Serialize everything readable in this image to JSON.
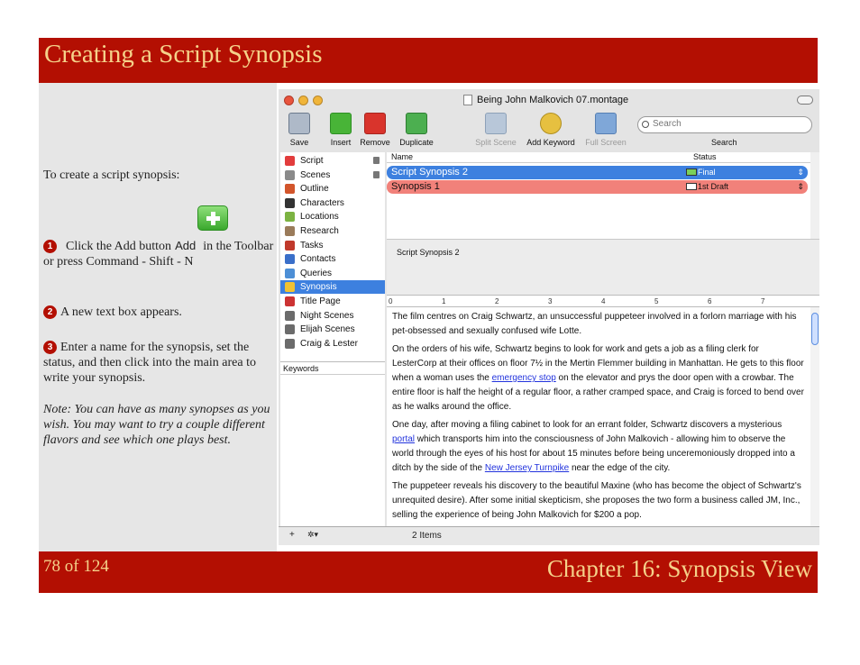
{
  "header": {
    "title": "Creating a Script Synopsis"
  },
  "instructions": {
    "intro": "To create a script synopsis:",
    "step1_num": "1",
    "step1_before": "Click the Add button",
    "step1_icon_label": "Add",
    "step1_after": "in the Toolbar or press Command - Shift - N",
    "step2_num": "2",
    "step2": "A new text box appears.",
    "step3_num": "3",
    "step3": "Enter a name for the synopsis, set the status, and then click into the main area to write your synopsis.",
    "note": "Note: You can have as many synopses as you wish. You may want to try a couple different flavors and see which one plays best."
  },
  "footer": {
    "page": "78 of 124",
    "chapter": "Chapter 16: Synopsis View"
  },
  "window": {
    "title": "Being John Malkovich 07.montage",
    "toolbar": {
      "save": "Save",
      "insert": "Insert",
      "remove": "Remove",
      "duplicate": "Duplicate",
      "split_scene": "Split Scene",
      "add_keyword": "Add Keyword",
      "full_screen": "Full Screen",
      "search_placeholder": "Search",
      "search_label": "Search"
    },
    "binder": [
      {
        "label": "Script",
        "icon_color": "#e23c3c",
        "locked": true
      },
      {
        "label": "Scenes",
        "icon_color": "#8a8a8a",
        "locked": true
      },
      {
        "label": "Outline",
        "icon_color": "#d2552b",
        "locked": false
      },
      {
        "label": "Characters",
        "icon_color": "#333333",
        "locked": false
      },
      {
        "label": "Locations",
        "icon_color": "#7cb342",
        "locked": false
      },
      {
        "label": "Research",
        "icon_color": "#9a7b5a",
        "locked": false
      },
      {
        "label": "Tasks",
        "icon_color": "#c0392b",
        "locked": false
      },
      {
        "label": "Contacts",
        "icon_color": "#3a6fc9",
        "locked": false
      },
      {
        "label": "Queries",
        "icon_color": "#4d8fd6",
        "locked": false
      },
      {
        "label": "Synopsis",
        "icon_color": "#f1c232",
        "locked": false,
        "selected": true
      },
      {
        "label": "Title Page",
        "icon_color": "#cc3333",
        "locked": false
      },
      {
        "label": "Night Scenes",
        "icon_color": "#6b6b6b",
        "locked": false
      },
      {
        "label": "Elijah Scenes",
        "icon_color": "#6b6b6b",
        "locked": false
      },
      {
        "label": "Craig & Lester",
        "icon_color": "#6b6b6b",
        "locked": false
      }
    ],
    "keywords_label": "Keywords",
    "list": {
      "col_name": "Name",
      "col_status": "Status",
      "rows": [
        {
          "name": "Script Synopsis 2",
          "status": "Final",
          "bg": "#3d80df",
          "fg": "#ffffff",
          "sq": "#7ad05a"
        },
        {
          "name": "Synopsis 1",
          "status": "1st Draft",
          "bg": "#f1817a",
          "fg": "#111111",
          "sq": "#ffffff"
        }
      ]
    },
    "selected_label": "Script Synopsis 2",
    "ruler": [
      "0",
      "1",
      "2",
      "3",
      "4",
      "5",
      "6",
      "7"
    ],
    "paragraphs": {
      "p1": "The film centres on Craig Schwartz, an unsuccessful puppeteer involved in a forlorn marriage with his pet-obsessed and sexually confused wife Lotte.",
      "p2a": "On the orders of his wife, Schwartz begins to look for work and gets a job as a filing clerk for LesterCorp at their offices on floor 7½ in the Mertin Flemmer building in Manhattan. He gets to this floor when a woman uses the ",
      "p2link": "emergency stop",
      "p2b": " on the elevator and prys the door open with a crowbar. The entire floor is half the height of a regular floor, a rather cramped space, and Craig is forced to bend over as he walks around the office.",
      "p3a": "One day, after moving a filing cabinet to look for an errant folder, Schwartz discovers a mysterious ",
      "p3link1": "portal",
      "p3b": " which transports him into the consciousness of John Malkovich - allowing him to observe the world through the eyes of his host for about 15 minutes before being unceremoniously dropped into a ditch by the side of the ",
      "p3link2": "New Jersey Turnpike",
      "p3c": " near the edge of the city.",
      "p4": "The puppeteer reveals his discovery to the beautiful Maxine (who has become the object of Schwartz's unrequited desire). After some initial skepticism, she proposes the two form a business called JM, Inc., selling the experience of being John Malkovich for $200 a pop."
    },
    "bottom": {
      "plus": "+",
      "gear": "✲▾",
      "items": "2 Items"
    }
  }
}
